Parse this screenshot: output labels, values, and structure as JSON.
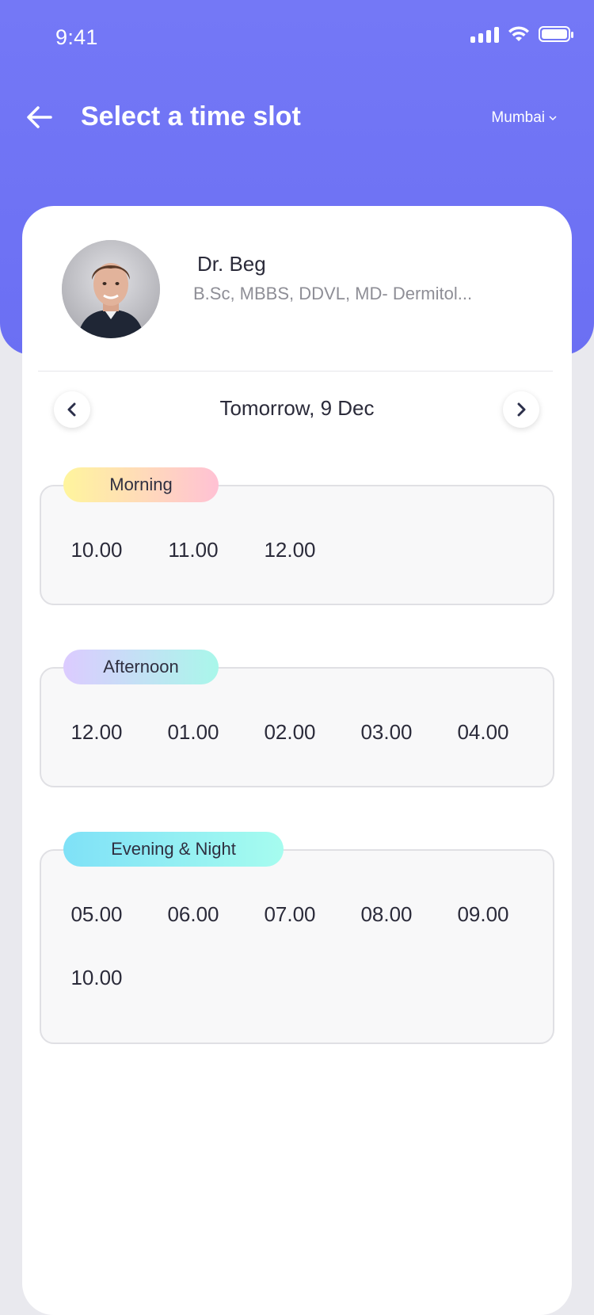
{
  "status": {
    "time": "9:41"
  },
  "header": {
    "title": "Select a time slot",
    "city": "Mumbai"
  },
  "doctor": {
    "name": "Dr. Beg",
    "qualifications": "B.Sc, MBBS, DDVL, MD- Dermitol..."
  },
  "date": {
    "label": "Tomorrow, 9 Dec"
  },
  "slots": {
    "morning": {
      "label": "Morning",
      "times": [
        "10.00",
        "11.00",
        "12.00"
      ]
    },
    "afternoon": {
      "label": "Afternoon",
      "times": [
        "12.00",
        "01.00",
        "02.00",
        "03.00",
        "04.00"
      ]
    },
    "evening": {
      "label": "Evening & Night",
      "times": [
        "05.00",
        "06.00",
        "07.00",
        "08.00",
        "09.00",
        "10.00"
      ]
    }
  },
  "colors": {
    "primary": "#6f73f5",
    "morning_gradient": [
      "#fff59d",
      "#ffc1d4"
    ],
    "afternoon_gradient": [
      "#dccbff",
      "#a9f7ea"
    ],
    "evening_gradient": [
      "#7fe1f7",
      "#a6fcef"
    ]
  },
  "icons": {
    "back": "arrow-left-icon",
    "city_dropdown": "chevron-down-icon",
    "prev_date": "chevron-left-icon",
    "next_date": "chevron-right-icon"
  }
}
